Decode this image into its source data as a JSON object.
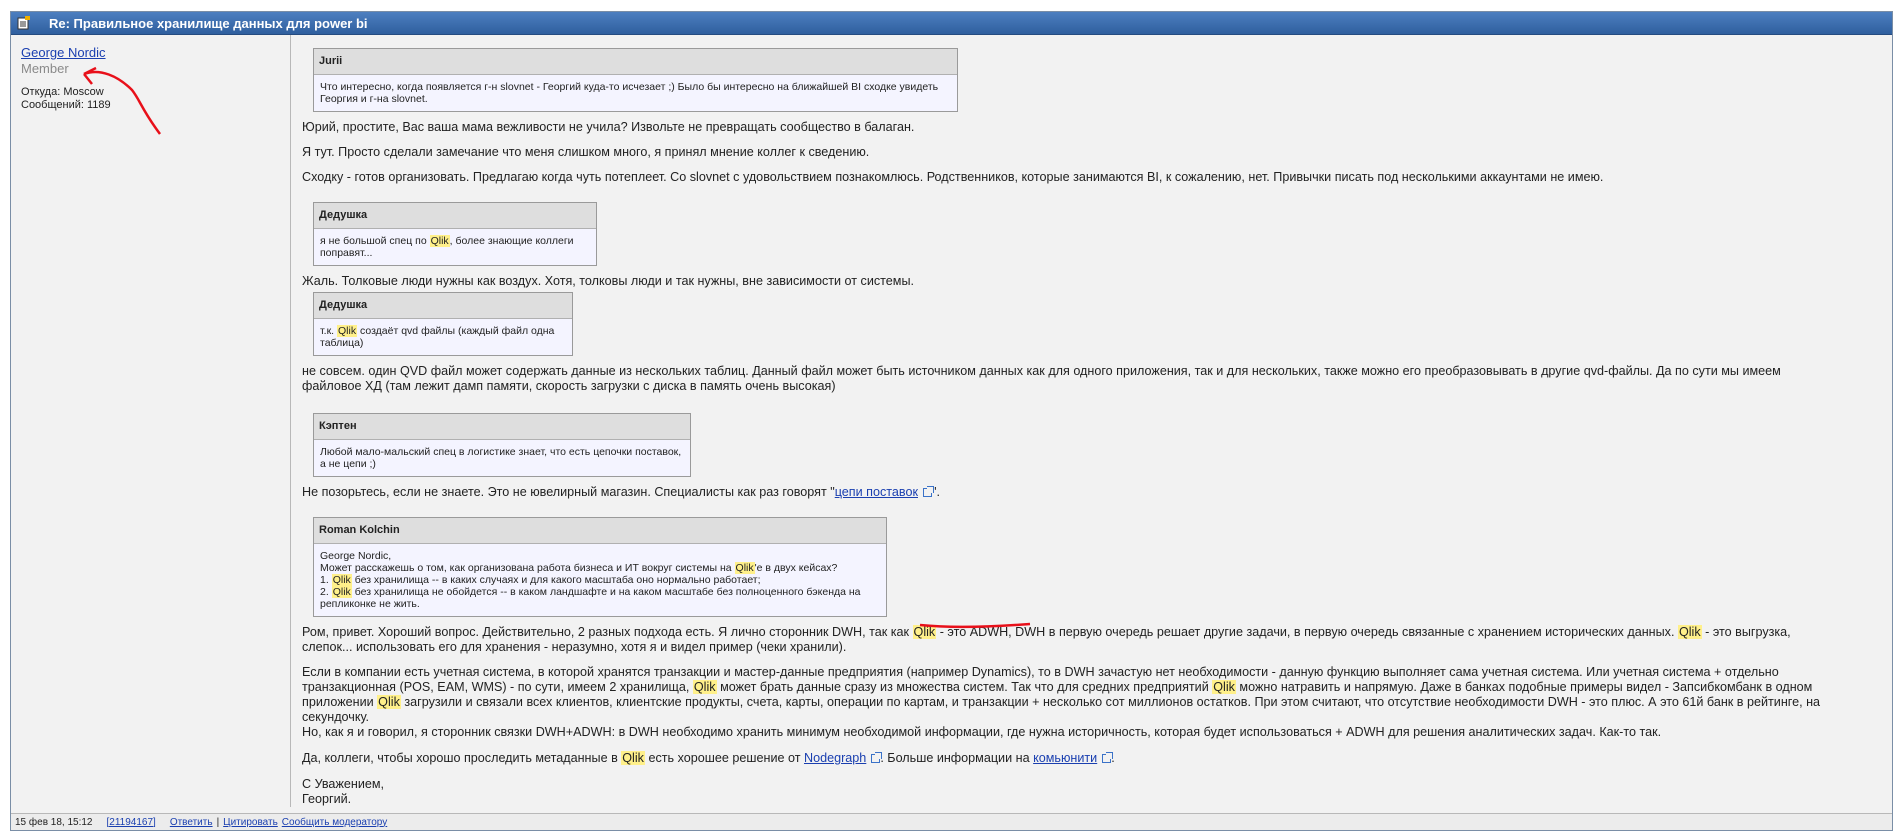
{
  "post": {
    "title": "Re: Правильное хранилище данных для power bi"
  },
  "author": {
    "name": "George Nordic",
    "rank": "Member",
    "location": "Откуда: Moscow",
    "messages": "Сообщений: 1189"
  },
  "quotes": [
    {
      "author": "Jurii",
      "text": "Что интересно, когда появляется г-н slovnet - Георгий куда-то исчезает ;) Было бы интересно на ближайшей BI сходке увидеть Георгия и г-на slovnet."
    },
    {
      "author": "Дедушка",
      "t1": "я не большой спец по ",
      "hl": "Qlik",
      "t2": ", более знающие коллеги поправят..."
    },
    {
      "author": "Дедушка",
      "t1": "т.к. ",
      "hl": "Qlik",
      "t2": " создаёт qvd файлы (каждый файл одна таблица)"
    },
    {
      "author": "Кэптен",
      "text": "Любой мало-мальский спец в логистике знает, что есть цепочки поставок, а не цепи ;)"
    },
    {
      "author": "Roman Kolchin",
      "l1": "George Nordic,",
      "l2a": "Может расскажешь о том, как организована работа бизнеса и ИТ вокруг системы на ",
      "l2hl": "Qlik",
      "l2b": "'е в двух кейсах?",
      "l3a": "1. ",
      "l3hl": "Qlik",
      "l3b": " без хранилища -- в каких случаях и для какого масштаба оно нормально работает;",
      "l4a": "2. ",
      "l4hl": "Qlik",
      "l4b": " без хранилища не обойдется -- в каком ландшафте и на каком масштабе без полноценного бэкенда на репликонке не жить."
    }
  ],
  "body": {
    "p1": "Юрий, простите, Вас ваша мама вежливости не учила? Извольте не превращать сообщество в балаган.",
    "p2": "Я тут. Просто сделали замечание что меня слишком много, я принял мнение коллег к сведению.",
    "p3": "Сходку - готов организовать. Предлагаю когда чуть потеплеет. Со slovnet с удовольствием познакомлюсь. Родственников, которые занимаются BI, к сожалению, нет. Привычки писать под несколькими аккаунтами не имею.",
    "p4": "Жаль. Толковые люди нужны как воздух. Хотя, толковы люди и так нужны, вне зависимости от системы.",
    "p5a": "не совсем. один QVD файл может содержать данные из нескольких таблиц. Данный файл может быть источником данных как для одного приложения, так и для нескольких, также можно его преобразовывать в другие qvd-файлы. Да по сути мы имеем",
    "p5b": "файловое ХД (там лежит дамп памяти, скорость загрузки с диска в память очень высокая)",
    "p6a": "Не позорьтесь, если не знаете. Это не ювелирный магазин. Специалисты как раз говорят \"",
    "p6link": "цепи поставок",
    "p6b": "\".",
    "p7a": "Ром, привет. Хороший вопрос. Действительно, 2 разных подхода есть. Я лично сторонник DWH, так как ",
    "p7hl1": "Qlik",
    "p7b": " - это ADWH, DWH в первую очередь решает другие задачи, в первую очередь связанные с хранением исторических данных. ",
    "p7hl2": "Qlik",
    "p7c": " - это выгрузка,",
    "p7d": "слепок... использовать его для хранения - неразумно, хотя я и видел пример (чеки хранили).",
    "p8a": "Если в компании есть учетная система, в которой хранятся транзакции и мастер-данные предприятия (например Dynamics), то в DWH зачастую нет необходимости - данную функцию выполняет сама учетная система. Или учетная система + отдельно",
    "p8b": "транзакционная (POS, EAM, WMS) - по сути, имеем 2 хранилища, ",
    "p8hl1": "Qlik",
    "p8c": " может брать данные сразу из множества систем. Так что для средних предприятий ",
    "p8hl2": "Qlik",
    "p8d": " можно натравить и напрямую. Даже в банках подобные примеры видел - Запсибкомбанк в одном",
    "p8e": "приложении ",
    "p8hl3": "Qlik",
    "p8f": " загрузили и связали всех клиентов, клиентские продукты, счета, карты, операции по картам, и транзакции + несколько сот миллионов остатков. При этом считают, что отсутствие необходимости DWH - это плюс. А это 61й банк в рейтинге, на",
    "p8g": "секундочку.",
    "p8h": "Но, как я и говорил, я сторонник связки DWH+ADWH: в DWH необходимо хранить минимум необходимой информации, где нужна историчность, которая будет использоваться + ADWH для решения аналитических задач. Как-то так.",
    "p9a": "Да, коллеги, чтобы хорошо проследить метаданные в ",
    "p9hl": "Qlik",
    "p9b": " есть хорошее решение от ",
    "p9link1": "Nodegraph",
    "p9c": ". Больше информации на ",
    "p9link2": "комьюнити",
    "p9d": ".",
    "sig1": "С Уважением,",
    "sig2": "Георгий."
  },
  "footer": {
    "datetime": "15 фев 18, 15:12",
    "post_id": "[21194167]",
    "reply": "Ответить",
    "separator": "|",
    "quote": "Цитировать",
    "report": "Сообщить модератору"
  },
  "colors": {
    "title_bar": "#2f5f9e",
    "highlight": "#fff08a",
    "annotation_red": "#e8101a"
  }
}
